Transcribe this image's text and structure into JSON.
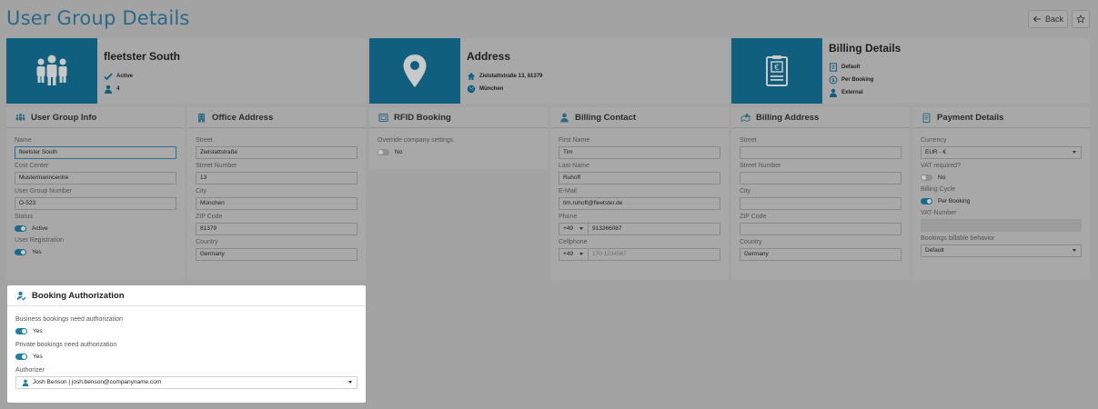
{
  "page": {
    "title": "User Group Details",
    "back_label": "Back"
  },
  "hero_group": {
    "title": "fleetster South",
    "status": "Active",
    "count": "4"
  },
  "hero_address": {
    "title": "Address",
    "street": "Zielstattstraße 13, 81379",
    "city": "München"
  },
  "hero_billing": {
    "title": "Billing Details",
    "mode": "Default",
    "cycle": "Per Booking",
    "type": "External"
  },
  "user_group_info": {
    "title": "User Group Info",
    "name_label": "Name",
    "name": "fleetster South",
    "cost_center_label": "Cost Center",
    "cost_center": "Mustermanncentre",
    "number_label": "User Group Number",
    "number": "O-523",
    "status_label": "Status",
    "status": "Active",
    "registration_label": "User Registration",
    "registration": "Yes"
  },
  "office_address": {
    "title": "Office Address",
    "street_label": "Street",
    "street": "Zielstattstraße",
    "street_number_label": "Street Number",
    "street_number": "13",
    "city_label": "City",
    "city": "München",
    "zip_label": "ZIP Code",
    "zip": "81379",
    "country_label": "Country",
    "country": "Germany"
  },
  "rfid": {
    "title": "RFID Booking",
    "override_label": "Override company settings",
    "override": "No"
  },
  "billing_contact": {
    "title": "Billing Contact",
    "first_name_label": "First Name",
    "first_name": "Tim",
    "last_name_label": "Last Name",
    "last_name": "Ruhoff",
    "email_label": "E-Mail",
    "email": "tim.ruhoff@fleetster.de",
    "phone_label": "Phone",
    "phone_cc": "+49",
    "phone": "913366087",
    "cell_label": "Cellphone",
    "cell_cc": "+49",
    "cell_placeholder": "170 1234567"
  },
  "billing_address": {
    "title": "Billing Address",
    "street_label": "Street",
    "street": "",
    "street_number_label": "Street Number",
    "street_number": "",
    "city_label": "City",
    "city": "",
    "zip_label": "ZIP Code",
    "zip": "",
    "country_label": "Country",
    "country": "Germany"
  },
  "payment_details": {
    "title": "Payment Details",
    "currency_label": "Currency",
    "currency": "EUR - €",
    "vat_label": "VAT required?",
    "vat": "No",
    "cycle_label": "Billing Cycle",
    "cycle": "Per Booking",
    "vat_number_label": "VAT-Number",
    "vat_number": "",
    "billable_label": "Bookings billable behavior",
    "billable": "Default"
  },
  "booking_auth": {
    "title": "Booking Authorization",
    "business_label": "Business bookings need authorization",
    "business": "Yes",
    "private_label": "Private bookings need authorization",
    "private": "Yes",
    "authorizer_label": "Authorizer",
    "authorizer": "Josh Benson | josh.benson@companyname.com"
  },
  "colors": {
    "accent": "#105f7f",
    "title": "#2a6a86",
    "toggle_on": "#1f7fa8"
  }
}
